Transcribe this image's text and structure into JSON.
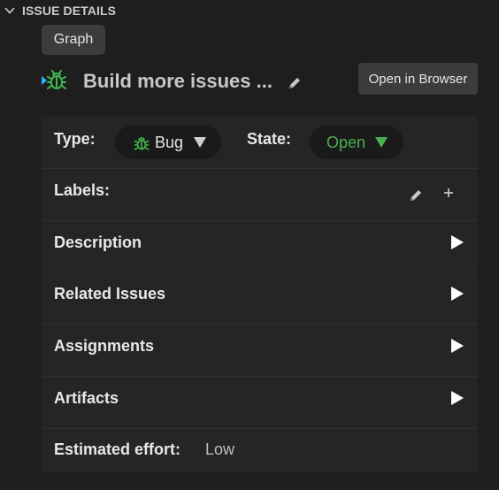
{
  "section": {
    "title": "ISSUE DETAILS",
    "expanded": true
  },
  "graph_button": {
    "label": "Graph"
  },
  "issue": {
    "title": "Build more issues ...",
    "type_icon": "bug-icon"
  },
  "open_browser_button": {
    "label": "Open in Browser"
  },
  "fields": {
    "type": {
      "label": "Type:",
      "value": "Bug",
      "icon": "bug-icon"
    },
    "state": {
      "label": "State:",
      "value": "Open"
    },
    "labels": {
      "label": "Labels:"
    },
    "description": {
      "label": "Description"
    },
    "related": {
      "label": "Related Issues"
    },
    "assignments": {
      "label": "Assignments"
    },
    "artifacts": {
      "label": "Artifacts"
    },
    "effort": {
      "label": "Estimated effort:",
      "value": "Low"
    }
  },
  "colors": {
    "background": "#1e1e1e",
    "panel": "#252526",
    "bug_green": "#3fb950",
    "bug_cyan": "#29b6f6",
    "state_open": "#4caf50"
  }
}
